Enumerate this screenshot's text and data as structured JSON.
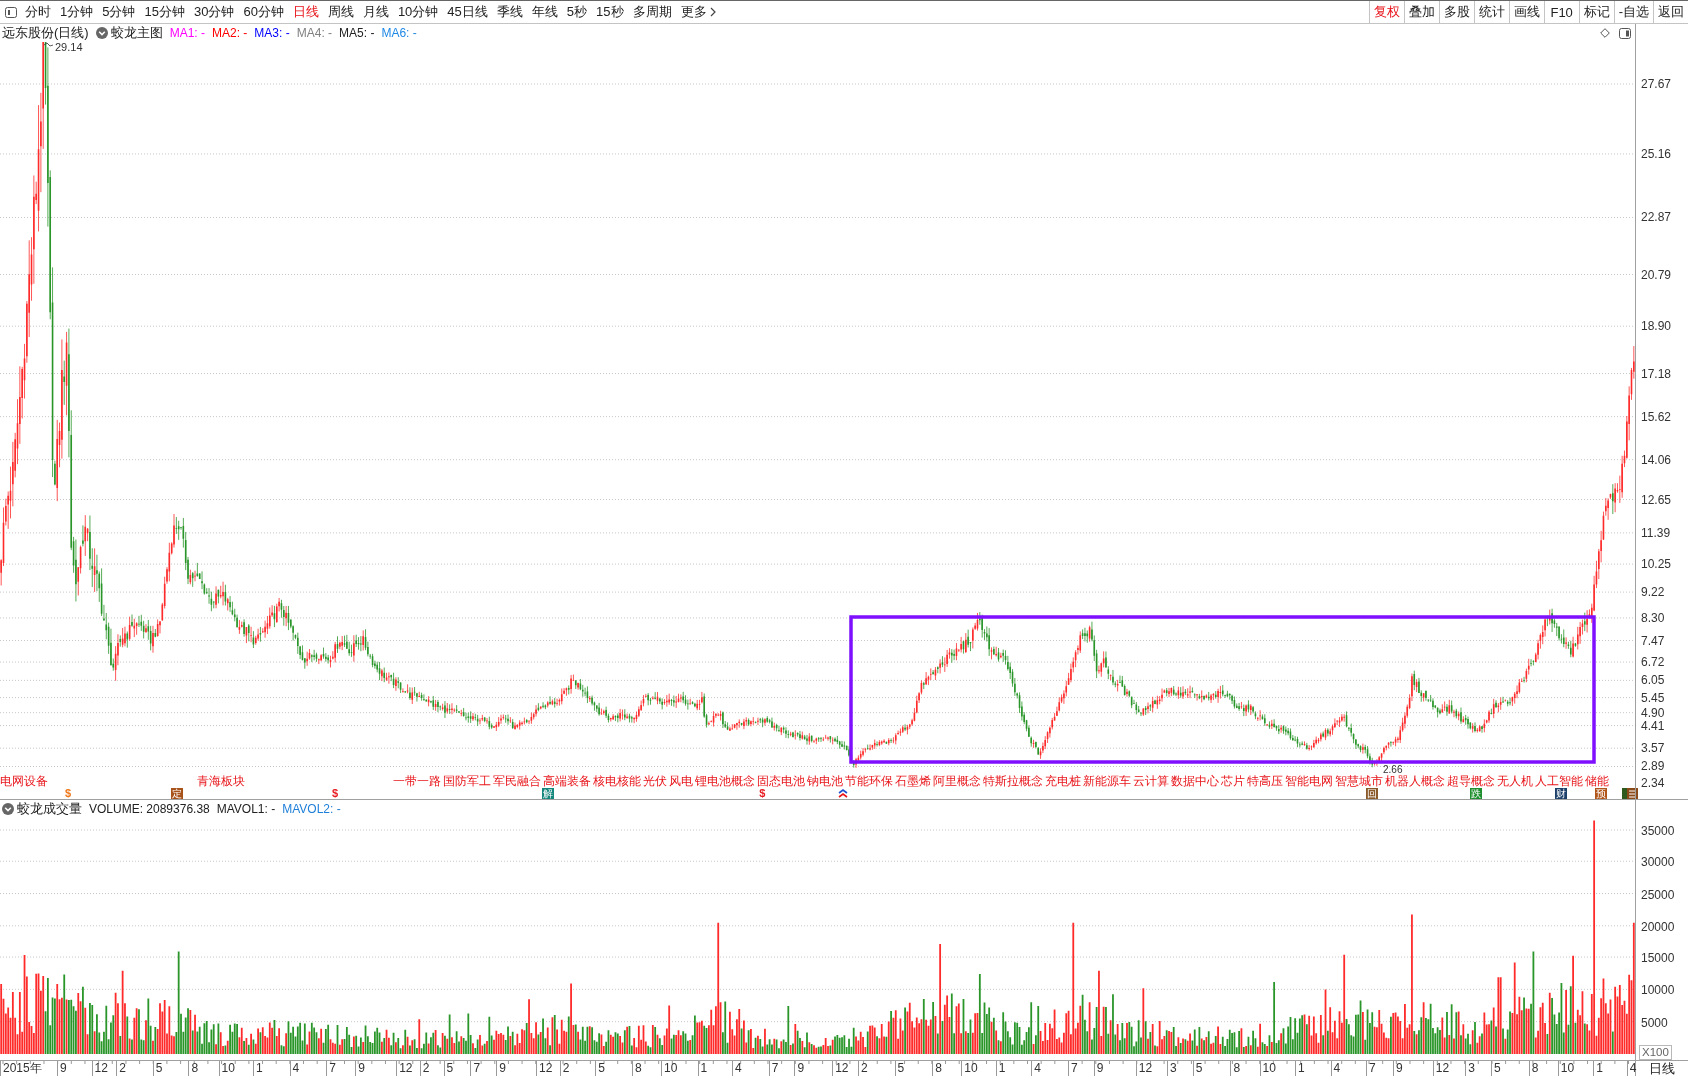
{
  "toolbar": {
    "periods": [
      {
        "label": "分时",
        "selected": false
      },
      {
        "label": "1分钟",
        "selected": false
      },
      {
        "label": "5分钟",
        "selected": false
      },
      {
        "label": "15分钟",
        "selected": false
      },
      {
        "label": "30分钟",
        "selected": false
      },
      {
        "label": "60分钟",
        "selected": false
      },
      {
        "label": "日线",
        "selected": true
      },
      {
        "label": "周线",
        "selected": false
      },
      {
        "label": "月线",
        "selected": false
      },
      {
        "label": "10分钟",
        "selected": false
      },
      {
        "label": "45日线",
        "selected": false
      },
      {
        "label": "季线",
        "selected": false
      },
      {
        "label": "年线",
        "selected": false
      },
      {
        "label": "5秒",
        "selected": false
      },
      {
        "label": "15秒",
        "selected": false
      },
      {
        "label": "多周期",
        "selected": false
      }
    ],
    "more": "更多",
    "tools": [
      {
        "label": "复权",
        "on": true
      },
      {
        "label": "叠加",
        "on": false
      },
      {
        "label": "多股",
        "on": false
      },
      {
        "label": "统计",
        "on": false
      },
      {
        "label": "画线",
        "on": false
      },
      {
        "label": "F10",
        "on": false
      },
      {
        "label": "标记",
        "on": false
      },
      {
        "label": "-自选",
        "on": false
      },
      {
        "label": "返回",
        "on": false
      }
    ]
  },
  "price_pane": {
    "title": "远东股份(日线)",
    "indicator": "蛟龙主图",
    "ma_legend": [
      {
        "label": "MA1: -",
        "color": "#ff00ff"
      },
      {
        "label": "MA2: -",
        "color": "#ff0000"
      },
      {
        "label": "MA3: -",
        "color": "#0000ff"
      },
      {
        "label": "MA4: -",
        "color": "#808080"
      },
      {
        "label": "MA5: -",
        "color": "#222222"
      },
      {
        "label": "MA6: -",
        "color": "#1e88e5"
      }
    ],
    "high_label": "29.14",
    "low_label": "2.66",
    "axis_labels": [
      "27.67",
      "25.16",
      "22.87",
      "20.79",
      "18.90",
      "17.18",
      "15.62",
      "14.06",
      "12.65",
      "11.39",
      "10.25",
      "9.22",
      "8.30",
      "7.47",
      "6.72",
      "6.05",
      "5.45",
      "4.90",
      "4.41",
      "3.57",
      "2.89",
      "2.34"
    ],
    "concept_tags": [
      "电网设备",
      "青海板块",
      "一带一路",
      "国防军工",
      "军民融合",
      "高端装备",
      "核电核能",
      "光伏",
      "风电",
      "锂电池概念",
      "固态电池",
      "钠电池",
      "节能环保",
      "石墨烯",
      "阿里概念",
      "特斯拉概念",
      "充电桩",
      "新能源车",
      "云计算",
      "数据中心",
      "芯片",
      "特高压",
      "智能电网",
      "智慧城市",
      "机器人概念",
      "超导概念",
      "无人机",
      "人工智能",
      "储能"
    ],
    "event_markers": [
      {
        "kind": "dollar",
        "label": "$",
        "color": "#f07a1e"
      },
      {
        "kind": "tag",
        "label": "定",
        "color": "#a8521c"
      },
      {
        "kind": "dollar",
        "label": "$",
        "color": "#e81e25"
      },
      {
        "kind": "tag",
        "label": "解",
        "color": "#14867c"
      },
      {
        "kind": "dollar",
        "label": "$",
        "color": "#e81e25"
      },
      {
        "kind": "arrow"
      },
      {
        "kind": "tag",
        "label": "回",
        "color": "#8a5a2a"
      },
      {
        "kind": "tag",
        "label": "跌",
        "color": "#1f8f2f"
      },
      {
        "kind": "tag",
        "label": "财",
        "color": "#1c3f6a"
      },
      {
        "kind": "tag",
        "label": "预",
        "color": "#b0561a"
      },
      {
        "kind": "stack"
      }
    ]
  },
  "volume_pane": {
    "indicator": "蛟龙成交量",
    "volume": "VOLUME: 2089376.38",
    "ma_legend": [
      {
        "label": "MAVOL1: -",
        "color": "#222222"
      },
      {
        "label": "MAVOL2: -",
        "color": "#1e7fd8"
      }
    ],
    "axis_labels": [
      "35000",
      "30000",
      "25000",
      "20000",
      "15000",
      "10000",
      "5000"
    ],
    "unit": "X100"
  },
  "time_axis": {
    "labels": [
      "2015年",
      "9",
      "12",
      "2",
      "5",
      "8",
      "10",
      "1",
      "4",
      "7",
      "9",
      "12",
      "2",
      "5",
      "7",
      "9",
      "12",
      "2",
      "5",
      "8",
      "10",
      "1",
      "4",
      "7",
      "9",
      "12",
      "2",
      "5",
      "8",
      "10",
      "1",
      "4",
      "7",
      "9",
      "12",
      "3",
      "5",
      "8",
      "10",
      "1",
      "4",
      "7",
      "9",
      "12",
      "3",
      "5",
      "8",
      "10",
      "1",
      "4"
    ],
    "period": "日线"
  }
}
